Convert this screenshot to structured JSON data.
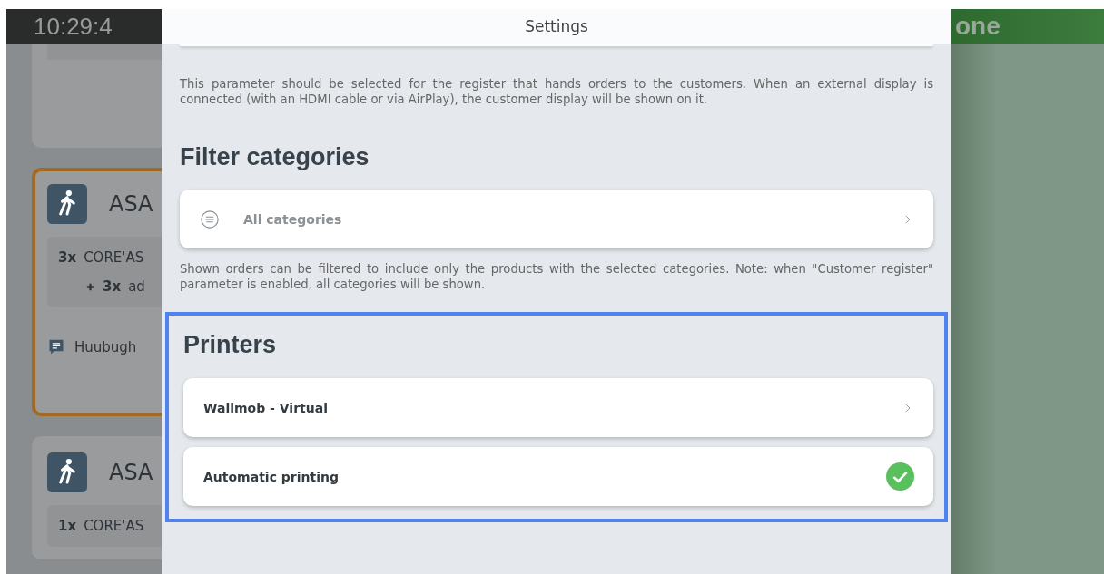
{
  "background": {
    "left_header": "10:29:4",
    "right_header": "one",
    "orders": [
      {
        "kind": "partial"
      },
      {
        "kind": "order",
        "highlighted": true,
        "title": "ASA",
        "lines": [
          {
            "qty": "3x",
            "name": "CORE'AS",
            "sub": false
          },
          {
            "qty": "3x",
            "name": "ad",
            "sub": true
          }
        ],
        "comment": "Huubugh"
      },
      {
        "kind": "order",
        "highlighted": false,
        "title": "ASA",
        "lines": [
          {
            "qty": "1x",
            "name": "CORE'AS",
            "sub": false
          }
        ]
      }
    ]
  },
  "settings": {
    "title": "Settings",
    "customer_display_note": "This parameter should be selected for the register that hands orders to the customers. When an external display is connected (with an HDMI cable or via AirPlay), the customer display will be shown on it.",
    "filter_heading": "Filter categories",
    "filter_row": {
      "label": "All categories"
    },
    "filter_note": "Shown orders can be filtered to include only the products with the selected categories. Note: when \"Customer register\" parameter is enabled, all categories will be shown.",
    "printers": {
      "highlighted": true,
      "heading": "Printers",
      "rows": [
        {
          "kind": "link",
          "label": "Wallmob - Virtual"
        },
        {
          "kind": "toggle",
          "label": "Automatic printing",
          "checked": true
        }
      ]
    }
  }
}
